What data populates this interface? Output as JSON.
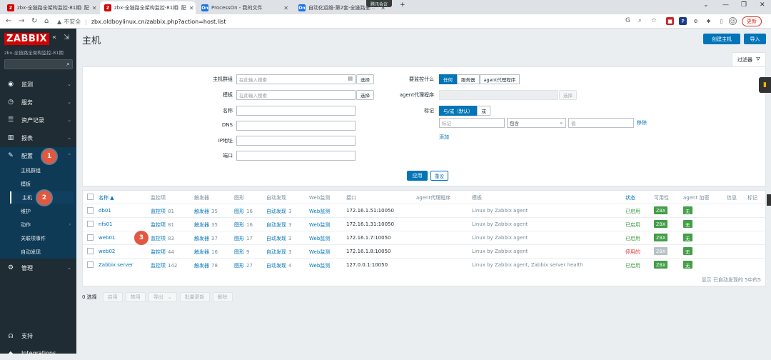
{
  "browser": {
    "tabs": [
      {
        "title": "zbx-全链路全架构监控-81期: 配",
        "fav": "Z",
        "color": "#d40000",
        "active": false
      },
      {
        "title": "zbx-全链路全架构监控-81期: 配",
        "fav": "Z",
        "color": "#d40000",
        "active": true
      },
      {
        "title": "ProcessOn - 我的文件",
        "fav": "On",
        "color": "#1a73e8",
        "active": false
      },
      {
        "title": "自动化运维-第2套-全链路全...",
        "fav": "On",
        "color": "#1a73e8",
        "active": false
      }
    ],
    "meeting_label": "腾讯会议",
    "security_label": "不安全",
    "url": "zbx.oldboylinux.cn/zabbix.php?action=host.list",
    "update_label": "更新"
  },
  "sidebar": {
    "logo": "ZABBIX",
    "subtitle": "zbx-全链路全架构监控-81期",
    "menu": [
      {
        "label": "监测",
        "icon": "eye-icon"
      },
      {
        "label": "服务",
        "icon": "clock-icon"
      },
      {
        "label": "资产记录",
        "icon": "list-icon"
      },
      {
        "label": "报表",
        "icon": "chart-icon"
      },
      {
        "label": "配置",
        "icon": "wrench-icon"
      },
      {
        "label": "管理",
        "icon": "gear-icon"
      }
    ],
    "config_submenu": [
      "主机群组",
      "模板",
      "主机",
      "维护",
      "动作",
      "关联项事件",
      "自动发现"
    ],
    "bottom": [
      {
        "label": "支持",
        "icon": "headset-icon"
      },
      {
        "label": "Integrations",
        "icon": "integrations-icon"
      }
    ],
    "annotations": [
      "1",
      "2",
      "3"
    ]
  },
  "header": {
    "title": "主机",
    "create_label": "创建主机",
    "import_label": "导入",
    "filter_label": "过滤器"
  },
  "filter": {
    "host_groups_label": "主机群组",
    "templates_label": "模板",
    "name_label": "名称",
    "dns_label": "DNS",
    "ip_label": "IP地址",
    "port_label": "端口",
    "search_placeholder": "在此输入搜索",
    "select_label": "选择",
    "monitored_by_label": "要监控什么",
    "monitored_by_options": [
      "任何",
      "服务器",
      "agent代理程序"
    ],
    "proxy_label": "agent代理程序",
    "tags_label": "标记",
    "tags_mode_options": [
      "与/或（默认）",
      "或"
    ],
    "tag_placeholder": "标记",
    "tag_operator": "包含",
    "value_placeholder": "值",
    "remove_label": "移除",
    "add_label": "添加",
    "apply_label": "应用",
    "reset_label": "重设"
  },
  "table": {
    "headers": {
      "name": "名称 ▲",
      "items": "监控项",
      "triggers": "触发器",
      "graphs": "图形",
      "discovery": "自动发现",
      "web": "Web监测",
      "interface": "接口",
      "proxy": "agent代理程序",
      "templates": "模板",
      "status": "状态",
      "availability": "可用性",
      "encryption": "agent 加密",
      "info": "信息",
      "tags": "标记"
    },
    "rows": [
      {
        "name": "db01",
        "items": "监控项",
        "items_n": "81",
        "triggers": "触发器",
        "triggers_n": "35",
        "graphs": "图形",
        "graphs_n": "16",
        "discovery": "自动发现",
        "discovery_n": "3",
        "web": "Web监测",
        "interface": "172.16.1.51:10050",
        "templates": "Linux by Zabbix agent",
        "status": "已启用",
        "status_ok": true,
        "zbx": "ZBX",
        "zbx_ok": true,
        "enc": "无"
      },
      {
        "name": "nfs01",
        "items": "监控项",
        "items_n": "81",
        "triggers": "触发器",
        "triggers_n": "35",
        "graphs": "图形",
        "graphs_n": "16",
        "discovery": "自动发现",
        "discovery_n": "3",
        "web": "Web监测",
        "interface": "172.16.1.31:10050",
        "templates": "Linux by Zabbix agent",
        "status": "已启用",
        "status_ok": true,
        "zbx": "ZBX",
        "zbx_ok": true,
        "enc": "无"
      },
      {
        "name": "web01",
        "items": "监控项",
        "items_n": "83",
        "triggers": "触发器",
        "triggers_n": "37",
        "graphs": "图形",
        "graphs_n": "17",
        "discovery": "自动发现",
        "discovery_n": "3",
        "web": "Web监测",
        "interface": "172.16.1.7:10050",
        "templates": "Linux by Zabbix agent",
        "status": "已启用",
        "status_ok": true,
        "zbx": "ZBX",
        "zbx_ok": true,
        "enc": "无"
      },
      {
        "name": "web02",
        "items": "监控项",
        "items_n": "44",
        "triggers": "触发器",
        "triggers_n": "16",
        "graphs": "图形",
        "graphs_n": "9",
        "discovery": "自动发现",
        "discovery_n": "3",
        "web": "Web监测",
        "interface": "172.16.1.8:10050",
        "templates": "Linux by Zabbix agent",
        "status": "停用的",
        "status_ok": false,
        "zbx": "ZBX",
        "zbx_ok": false,
        "enc": "无"
      },
      {
        "name": "Zabbix server",
        "items": "监控项",
        "items_n": "142",
        "triggers": "触发器",
        "triggers_n": "78",
        "graphs": "图形",
        "graphs_n": "27",
        "discovery": "自动发现",
        "discovery_n": "4",
        "web": "Web监测",
        "interface": "127.0.0.1:10050",
        "templates": "Linux by Zabbix agent, Zabbix server health",
        "status": "已启用",
        "status_ok": true,
        "zbx": "ZBX",
        "zbx_ok": true,
        "enc": "无"
      }
    ],
    "footer": "显示 已自动发现的 5中的5"
  },
  "bulk": {
    "selected": "0 选择",
    "enable": "启用",
    "disable": "禁用",
    "export": "导出",
    "mass_update": "批量更新",
    "delete": "删除"
  }
}
